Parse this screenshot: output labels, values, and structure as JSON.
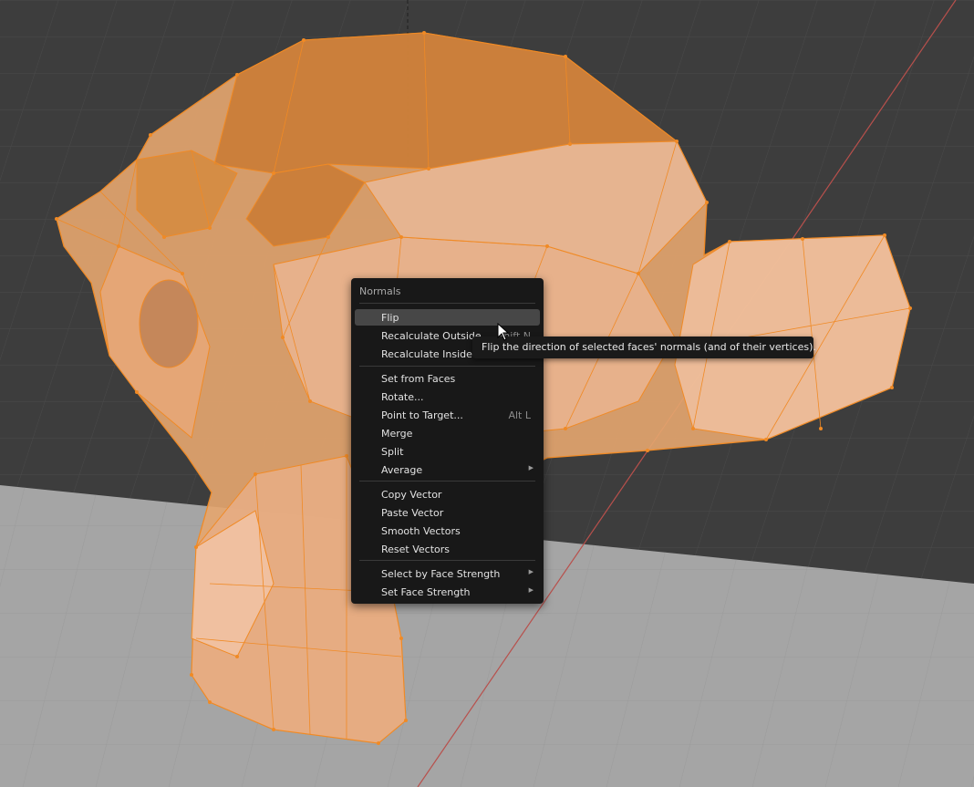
{
  "menu": {
    "title": "Normals",
    "items": [
      {
        "label": "Flip",
        "shortcut": "",
        "submenu": false,
        "active": true
      },
      {
        "label": "Recalculate Outside",
        "shortcut": "Shift N",
        "submenu": false
      },
      {
        "label": "Recalculate Inside",
        "shortcut": "",
        "submenu": false
      },
      {
        "label": "Set from Faces",
        "shortcut": "",
        "submenu": false
      },
      {
        "label": "Rotate...",
        "shortcut": "",
        "submenu": false
      },
      {
        "label": "Point to Target...",
        "shortcut": "Alt L",
        "submenu": false
      },
      {
        "label": "Merge",
        "shortcut": "",
        "submenu": false
      },
      {
        "label": "Split",
        "shortcut": "",
        "submenu": false
      },
      {
        "label": "Average",
        "shortcut": "",
        "submenu": true
      },
      {
        "label": "Copy Vector",
        "shortcut": "",
        "submenu": false
      },
      {
        "label": "Paste Vector",
        "shortcut": "",
        "submenu": false
      },
      {
        "label": "Smooth Vectors",
        "shortcut": "",
        "submenu": false
      },
      {
        "label": "Reset Vectors",
        "shortcut": "",
        "submenu": false
      },
      {
        "label": "Select by Face Strength",
        "shortcut": "",
        "submenu": true
      },
      {
        "label": "Set Face Strength",
        "shortcut": "",
        "submenu": true
      }
    ],
    "submenu_arrow": "▶"
  },
  "tooltip": {
    "text": "Flip the direction of selected faces' normals (and of their vertices)."
  },
  "colors": {
    "background": "#3d3d3d",
    "floor": "#a5a5a5",
    "mesh_fill": "#e6a66f",
    "mesh_edge": "#f08a25",
    "x_axis": "#b8504c",
    "menu_bg": "#181818",
    "highlight": "#474747"
  }
}
